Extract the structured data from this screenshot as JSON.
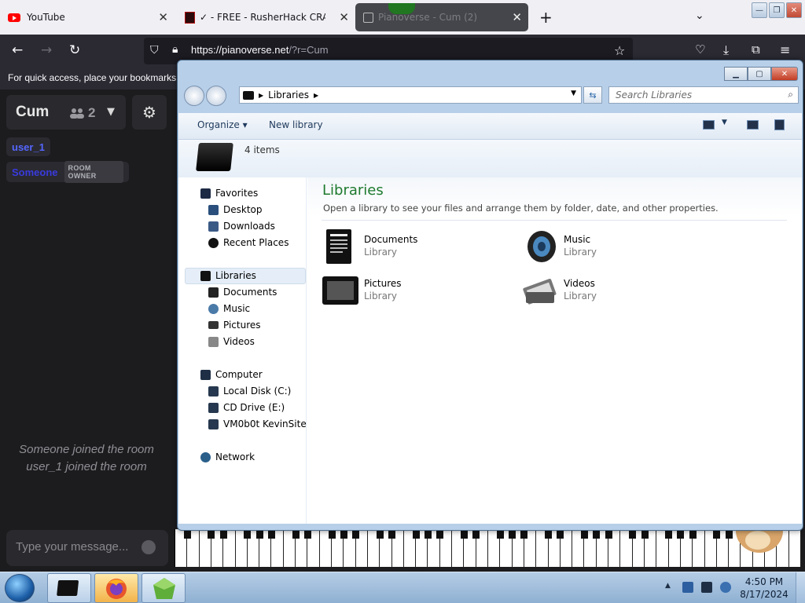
{
  "browser": {
    "tabs": [
      {
        "title": "YouTube"
      },
      {
        "title": "✓ - FREE - RusherHack CRACKED"
      },
      {
        "title": "Pianoverse - Cum (2)"
      }
    ],
    "url": {
      "host": "https://pianoverse.net",
      "rest": "/?r=Cum"
    },
    "bookmarks_hint": "For quick access, place your bookmarks here on the bookmarks toolbar."
  },
  "pianoverse": {
    "room_name": "Cum",
    "user_count": "2",
    "users": [
      {
        "name": "user_1"
      },
      {
        "name": "Someone",
        "badge": "ROOM OWNER"
      }
    ],
    "chat": [
      "Someone joined the room",
      "user_1 joined the room"
    ],
    "chat_placeholder": "Type your message..."
  },
  "explorer": {
    "address": "Libraries",
    "search_placeholder": "Search Libraries",
    "toolbar": {
      "organize": "Organize",
      "new_library": "New library"
    },
    "item_count": "4 items",
    "nav": {
      "favorites": "Favorites",
      "desktop": "Desktop",
      "downloads": "Downloads",
      "recent_places": "Recent Places",
      "libraries": "Libraries",
      "documents": "Documents",
      "music": "Music",
      "pictures": "Pictures",
      "videos": "Videos",
      "computer": "Computer",
      "local_disk": "Local Disk (C:)",
      "cd_drive": "CD Drive (E:)",
      "vmsite": "VM0b0t KevinSite",
      "network": "Network"
    },
    "content": {
      "title": "Libraries",
      "description": "Open a library to see your files and arrange them by folder, date, and other properties.",
      "libraries": [
        {
          "name": "Documents",
          "type": "Library",
          "icon": "documents-icon"
        },
        {
          "name": "Music",
          "type": "Library",
          "icon": "music-icon"
        },
        {
          "name": "Pictures",
          "type": "Library",
          "icon": "pictures-icon"
        },
        {
          "name": "Videos",
          "type": "Library",
          "icon": "videos-icon"
        }
      ]
    }
  },
  "taskbar": {
    "time": "4:50 PM",
    "date": "8/17/2024"
  }
}
